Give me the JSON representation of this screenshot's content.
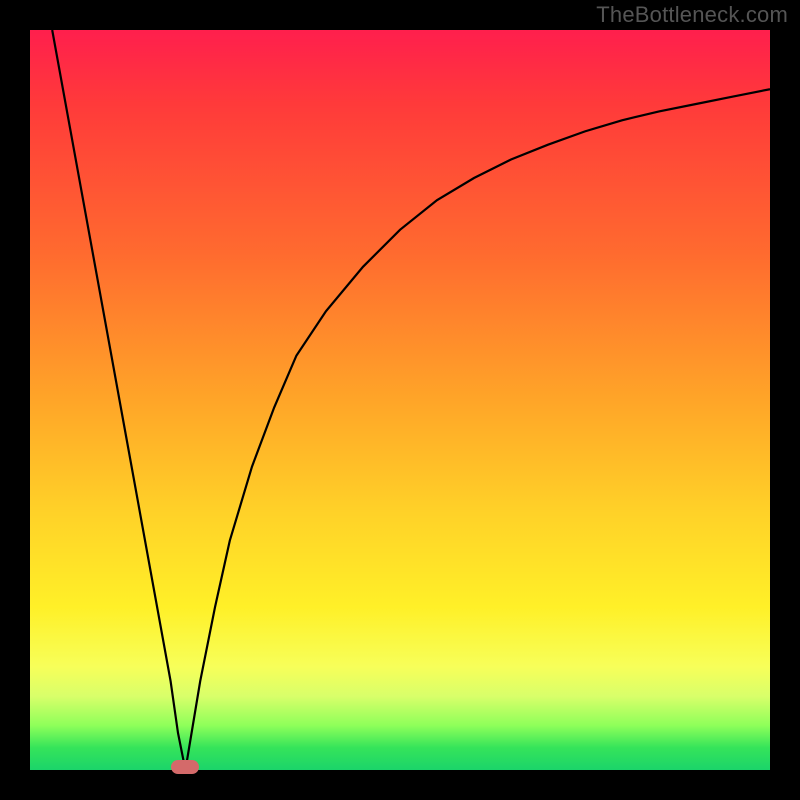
{
  "watermark": {
    "text": "TheBottleneck.com"
  },
  "colors": {
    "frame_bg": "#000000",
    "curve": "#000000",
    "marker": "#d46a6a",
    "gradient_stops": [
      "#ff1f4d",
      "#ff3a3a",
      "#ff6a2f",
      "#ffa528",
      "#ffd128",
      "#fff028",
      "#f7ff59",
      "#d9ff6a",
      "#8eff5a",
      "#35e45a",
      "#1bd46a"
    ]
  },
  "chart_data": {
    "type": "line",
    "title": "",
    "xlabel": "",
    "ylabel": "",
    "xlim": [
      0,
      100
    ],
    "ylim": [
      0,
      100
    ],
    "grid": false,
    "legend": false,
    "notch_x": 21,
    "series": [
      {
        "name": "left-branch",
        "x": [
          3,
          5,
          7,
          9,
          11,
          13,
          15,
          17,
          19,
          20,
          21
        ],
        "y": [
          100,
          89,
          78,
          67,
          56,
          45,
          34,
          23,
          12,
          5,
          0
        ]
      },
      {
        "name": "right-branch",
        "x": [
          21,
          22,
          23,
          25,
          27,
          30,
          33,
          36,
          40,
          45,
          50,
          55,
          60,
          65,
          70,
          75,
          80,
          85,
          90,
          95,
          100
        ],
        "y": [
          0,
          6,
          12,
          22,
          31,
          41,
          49,
          56,
          62,
          68,
          73,
          77,
          80,
          82.5,
          84.5,
          86.3,
          87.8,
          89,
          90,
          91,
          92
        ]
      }
    ],
    "marker": {
      "x": 21,
      "y": 0,
      "shape": "rounded-rect"
    }
  }
}
